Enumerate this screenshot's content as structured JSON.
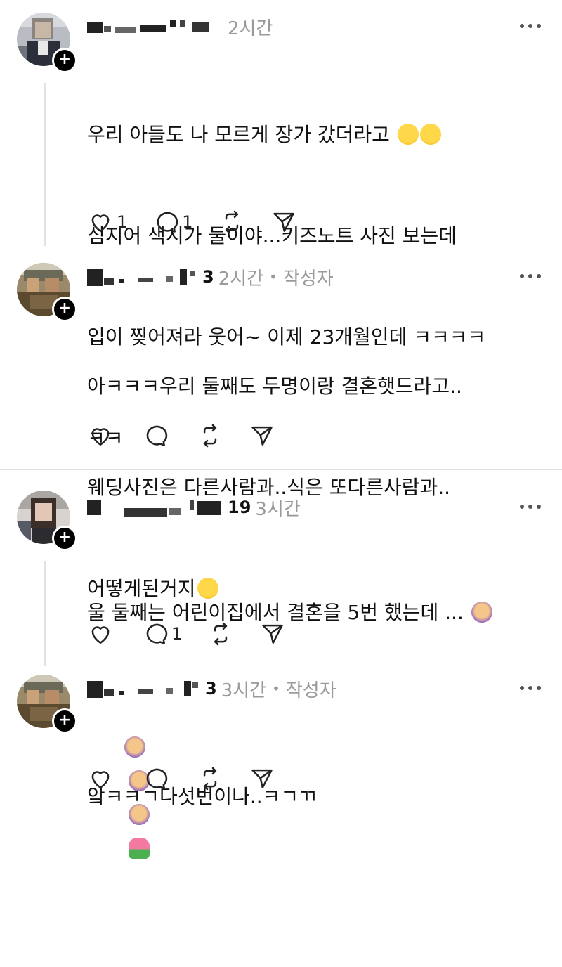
{
  "posts": [
    {
      "handle_tail": "",
      "time": "2시간",
      "author_tag": "",
      "text": "우리 아들도 나 모르게 장가 갔더라고",
      "text_lines": [
        "우리 아들도 나 모르게 장가 갔더라고 ",
        "심지어 색시가 둘이야...키즈노트 사진 보는데",
        "입이 찢어져라 웃어~ 이제 23개월인데 ㅋㅋㅋㅋ",
        "ㅋㅋ"
      ],
      "emoji": [
        "rolling-laughing-emoji",
        "rolling-laughing-emoji"
      ],
      "likes": "1",
      "replies": "1",
      "reposts": "",
      "avatar_icon": "profile-photo-blurred"
    },
    {
      "handle_tail": "3",
      "time": "2시간",
      "separator": "•",
      "author_tag": "작성자",
      "text_lines": [
        "아ㅋㅋㅋ우리 둘째도 두명이랑 결혼햇드라고..",
        "웨딩사진은 다른사람과..식은 또다른사람과..",
        "어떻게된거지"
      ],
      "emoji": [
        "hand-over-mouth-emoji"
      ],
      "likes": "",
      "replies": "",
      "reposts": "",
      "avatar_icon": "profile-photo-blurred"
    },
    {
      "handle_tail": "19",
      "time": "3시간",
      "author_tag": "",
      "text_lines": [
        "울 둘째는 어린이집에서 결혼을 5번 했는데 ... ",
        ""
      ],
      "emoji": [
        "facepalm-woman-emoji",
        "facepalm-woman-emoji",
        "facepalm-woman-emoji",
        "facepalm-woman-emoji",
        "tulip-emoji"
      ],
      "likes": "",
      "replies": "1",
      "reposts": "",
      "avatar_icon": "profile-photo-blurred"
    },
    {
      "handle_tail": "3",
      "time": "3시간",
      "separator": "•",
      "author_tag": "작성자",
      "text_lines": [
        "앜ㅋㅋㄱ다섯번이나..ㅋㄱㄲ"
      ],
      "emoji": [],
      "likes": "",
      "replies": "",
      "reposts": "",
      "avatar_icon": "profile-photo-blurred"
    }
  ],
  "icons": {
    "like": "heart-icon",
    "reply": "comment-bubble-icon",
    "repost": "repost-arrows-icon",
    "share": "send-paper-plane-icon",
    "more": "more-dots-icon",
    "follow": "plus-icon"
  },
  "colors": {
    "text": "#111111",
    "muted": "#9a9a9a",
    "divider": "#e0e0e0",
    "thread_line": "#e2e2e2"
  }
}
